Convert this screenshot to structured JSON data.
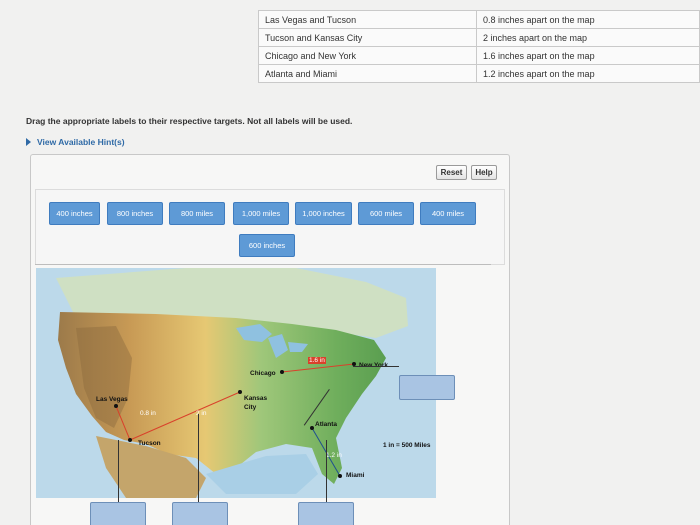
{
  "table": {
    "rows": [
      {
        "cities": "Las Vegas and Tucson",
        "distance": "0.8 inches apart on the map"
      },
      {
        "cities": "Tucson and Kansas City",
        "distance": "2 inches apart on the map"
      },
      {
        "cities": "Chicago and New York",
        "distance": "1.6 inches apart on the map"
      },
      {
        "cities": "Atlanta and Miami",
        "distance": "1.2 inches apart on the map"
      }
    ]
  },
  "instruction": "Drag the appropriate labels to their respective targets. Not all labels will be used.",
  "hint_link": "View Available Hint(s)",
  "toolbar": {
    "reset": "Reset",
    "help": "Help"
  },
  "labels": [
    "400 inches",
    "800 inches",
    "800 miles",
    "1,000 miles",
    "1,000 inches",
    "600 miles",
    "400 miles",
    "600 inches"
  ],
  "map": {
    "cities": {
      "las_vegas": "Las Vegas",
      "tucson": "Tucson",
      "kansas_city_1": "Kansas",
      "kansas_city_2": "City",
      "chicago": "Chicago",
      "new_york": "New York",
      "atlanta": "Atlanta",
      "miami": "Miami"
    },
    "measures": {
      "lv_tucson": "0.8 in",
      "tucson_kc": "2 in",
      "chi_ny": "1.6 in",
      "atl_miami": "1.2 in"
    },
    "scale": "1 in = 500 Miles"
  },
  "colors": {
    "chip": "#5e9ad6",
    "target": "#a9c4e3",
    "measure_line": "#d9412b"
  }
}
